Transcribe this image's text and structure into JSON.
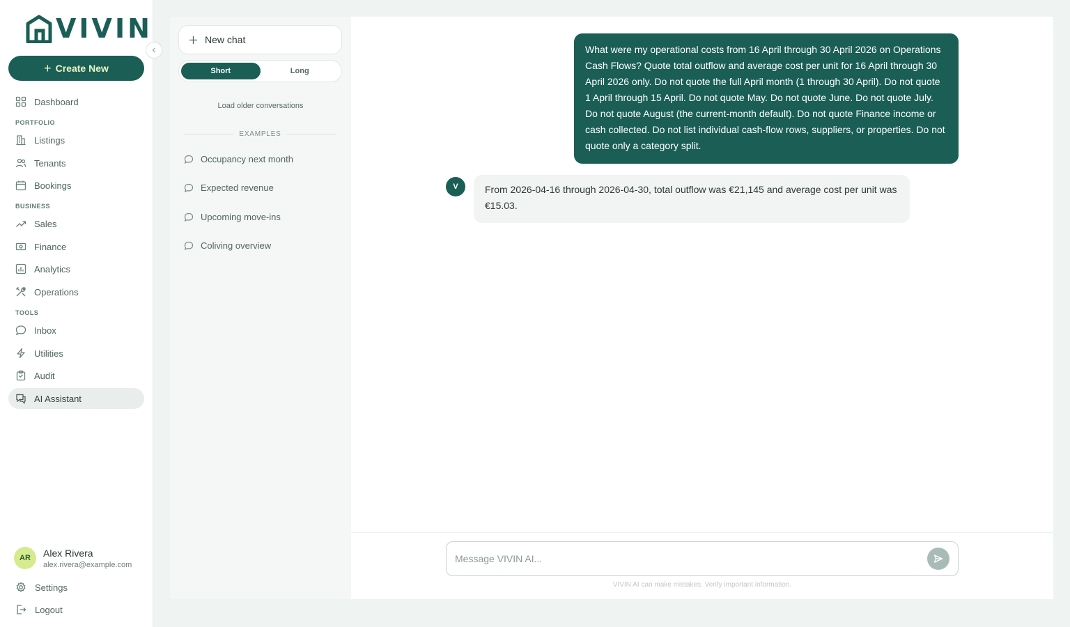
{
  "brand": {
    "name": "VIVIN",
    "accent": "#1b5e56"
  },
  "sidebar": {
    "create_label": "Create New",
    "sections": {
      "portfolio": "PORTFOLIO",
      "business": "BUSINESS",
      "tools": "TOOLS"
    },
    "items": [
      {
        "label": "Dashboard",
        "icon": "grid-icon"
      },
      {
        "label": "Listings",
        "icon": "building-icon"
      },
      {
        "label": "Tenants",
        "icon": "users-icon"
      },
      {
        "label": "Bookings",
        "icon": "calendar-icon"
      },
      {
        "label": "Sales",
        "icon": "trend-up-icon"
      },
      {
        "label": "Finance",
        "icon": "banknote-icon"
      },
      {
        "label": "Analytics",
        "icon": "bar-chart-icon"
      },
      {
        "label": "Operations",
        "icon": "tools-icon"
      },
      {
        "label": "Inbox",
        "icon": "chat-bubble-icon"
      },
      {
        "label": "Utilities",
        "icon": "bolt-icon"
      },
      {
        "label": "Audit",
        "icon": "clipboard-icon"
      },
      {
        "label": "AI Assistant",
        "icon": "chat-bubbles-icon",
        "active": true
      }
    ],
    "user": {
      "initials": "AR",
      "name": "Alex Rivera",
      "email": "alex.rivera@example.com"
    },
    "settings_label": "Settings",
    "logout_label": "Logout"
  },
  "chat_panel": {
    "new_chat_label": "New chat",
    "toggle": {
      "short": "Short",
      "long": "Long",
      "selected": "Short"
    },
    "load_older": "Load older conversations",
    "examples_heading": "EXAMPLES",
    "examples": [
      "Occupancy next month",
      "Expected revenue",
      "Upcoming move-ins",
      "Coliving overview"
    ]
  },
  "conversation": {
    "user_message": "What were my operational costs from 16 April through 30 April 2026 on Operations Cash Flows? Quote total outflow and average cost per unit for 16 April through 30 April 2026 only. Do not quote the full April month (1 through 30 April). Do not quote 1 April through 15 April. Do not quote May. Do not quote June. Do not quote July. Do not quote August (the current-month default). Do not quote Finance income or cash collected. Do not list individual cash-flow rows, suppliers, or properties. Do not quote only a category split.",
    "ai_avatar": "V",
    "ai_message": "From 2026-04-16 through 2026-04-30, total outflow was €21,145 and average cost per unit was €15.03."
  },
  "composer": {
    "placeholder": "Message VIVIN AI...",
    "value": "",
    "disclaimer": "VIVIN AI can make mistakes. Verify important information."
  }
}
